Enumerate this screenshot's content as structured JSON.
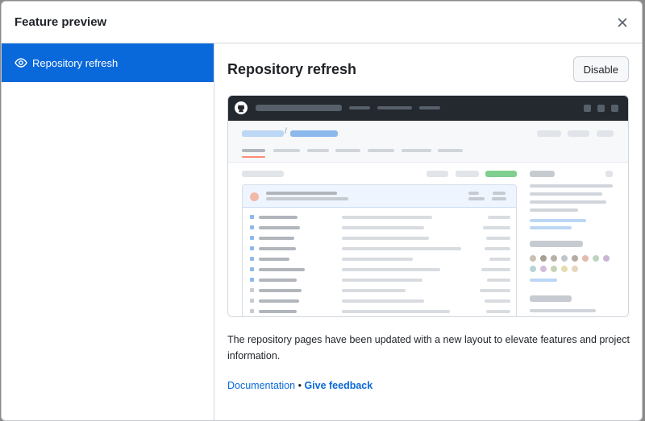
{
  "dialog": {
    "title": "Feature preview",
    "close_icon": "x-icon"
  },
  "sidebar": {
    "items": [
      {
        "label": "Repository refresh",
        "icon": "eye-icon",
        "selected": true
      }
    ]
  },
  "main": {
    "title": "Repository refresh",
    "disable_label": "Disable",
    "description": "The repository pages have been updated with a new layout to elevate features and project information.",
    "links": {
      "documentation": "Documentation",
      "separator": "•",
      "feedback": "Give feedback"
    }
  },
  "colors": {
    "accent": "#0969da",
    "preview_header": "#24292f",
    "highlight_tab": "#fd8c73",
    "green_button": "#7fcf8e"
  }
}
